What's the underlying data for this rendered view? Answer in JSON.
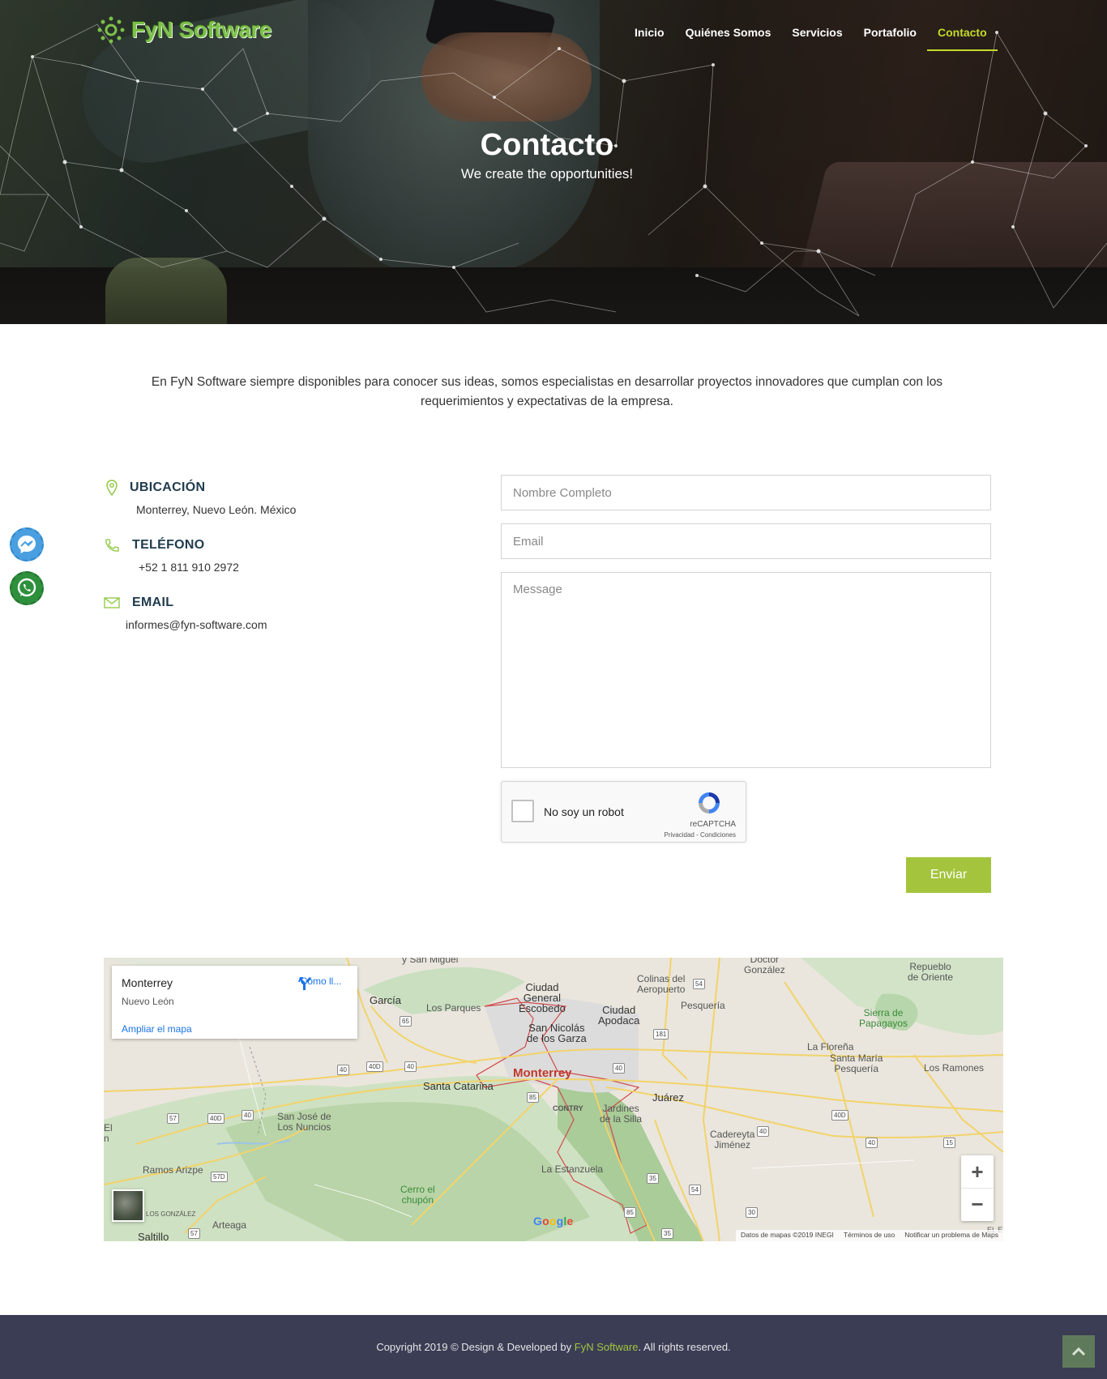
{
  "header": {
    "logo_text": "FyN Software",
    "nav": [
      {
        "label": "Inicio"
      },
      {
        "label": "Quiénes Somos"
      },
      {
        "label": "Servicios"
      },
      {
        "label": "Portafolio"
      },
      {
        "label": "Contacto",
        "active": true
      }
    ]
  },
  "hero": {
    "title": "Contacto",
    "subtitle": "We create the opportunities!"
  },
  "intro": "En FyN Software siempre disponibles para conocer sus ideas, somos especialistas en desarrollar proyectos innovadores que cumplan con los requerimientos y expectativas de la empresa.",
  "contact_info": {
    "location_label": "UBICACIÓN",
    "location_value": "Monterrey, Nuevo León. México",
    "phone_label": "TELÉFONO",
    "phone_value": "+52 1 811 910 2972",
    "email_label": "EMAIL",
    "email_value": "informes@fyn-software.com"
  },
  "form": {
    "name_placeholder": "Nombre Completo",
    "email_placeholder": "Email",
    "message_placeholder": "Message",
    "recaptcha_label": "No soy un robot",
    "recaptcha_brand": "reCAPTCHA",
    "recaptcha_links": "Privacidad - Condiciones",
    "submit_label": "Enviar"
  },
  "map": {
    "card_title": "Monterrey",
    "card_subtitle": "Nuevo León",
    "card_link": "Ampliar el mapa",
    "card_directions": "Cómo ll...",
    "labels": {
      "san_miguel": "y San Miguel",
      "doctor_gonzalez": "Doctor\nGonzález",
      "repueblo": "Repueblo\nde Oriente",
      "garcia": "García",
      "ciudad_general_escobedo": "Ciudad\nGeneral\nEscobedo",
      "colinas": "Colinas del\nAeropuerto",
      "pesqueria": "Pesquería",
      "los_parques": "Los Parques",
      "ciudad_apodaca": "Ciudad\nApodaca",
      "san_nicolas": "San Nicolás\nde los Garza",
      "sierra_papagayos": "Sierra de\nPapagayos",
      "la_florena": "La Floreña",
      "santa_maria": "Santa María\nPesquería",
      "los_ramones": "Los Ramones",
      "monterrey": "Monterrey",
      "santa_catarina": "Santa Catarina",
      "juarez": "Juárez",
      "contry": "CONTRY",
      "jardines": "Jardines\nde la Silla",
      "san_jose": "San José de\nLos Nuncios",
      "cadereyta": "Cadereyta\nJiménez",
      "el": "El\nn",
      "ramos_arizpe": "Ramos Arizpe",
      "la_estanzuela": "La Estanzuela",
      "cerro_chupon": "Cerro el\nchupón",
      "los_gonzalez": "LOS GONZÁLEZ",
      "arteaga": "Arteaga",
      "saltillo": "Saltillo",
      "el_right": "EL E"
    },
    "shields": [
      "65",
      "54",
      "181",
      "40D",
      "40",
      "40",
      "85",
      "40",
      "57",
      "40D",
      "40",
      "40D",
      "40",
      "15",
      "57D",
      "35",
      "54",
      "85",
      "30",
      "35",
      "40",
      "57"
    ],
    "google": "Google",
    "attribution": [
      "Datos de mapas ©2019 INEGI",
      "Términos de uso",
      "Notificar un problema de Maps"
    ]
  },
  "footer": {
    "prefix": "Copyright 2019 © Design & Developed by ",
    "brand": "FyN Software",
    "suffix": ". All rights reserved."
  },
  "colors": {
    "accent": "#c2db2c",
    "button": "#a4c43d",
    "footer_bg": "#3b3d55",
    "heading": "#1f3b4d",
    "icon_green": "#8cc63f"
  },
  "icons": {
    "location": "map-pin-icon",
    "phone": "phone-icon",
    "email": "envelope-icon",
    "messenger": "messenger-icon",
    "whatsapp": "whatsapp-icon",
    "directions": "directions-icon",
    "scroll_top": "chevron-up-icon"
  }
}
